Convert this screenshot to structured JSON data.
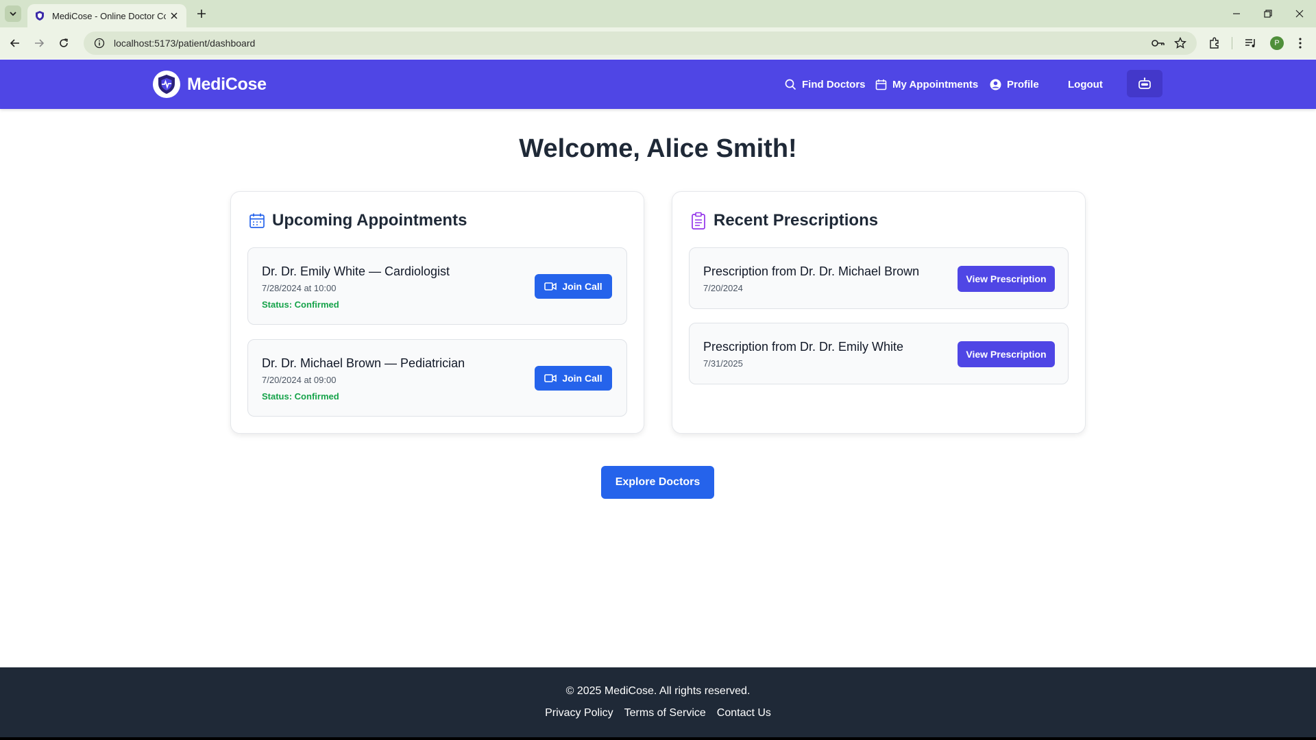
{
  "browser": {
    "tab_title": "MediCose - Online Doctor Con",
    "url": "localhost:5173/patient/dashboard",
    "profile_initial": "P"
  },
  "header": {
    "brand": "MediCose",
    "nav": {
      "find_doctors": "Find Doctors",
      "my_appointments": "My Appointments",
      "profile": "Profile",
      "logout": "Logout"
    }
  },
  "main": {
    "welcome": "Welcome, Alice Smith!",
    "appointments": {
      "title": "Upcoming Appointments",
      "items": [
        {
          "doctor": "Dr. Dr. Emily White — Cardiologist",
          "datetime": "7/28/2024 at 10:00",
          "status": "Status: Confirmed",
          "action": "Join Call"
        },
        {
          "doctor": "Dr. Dr. Michael Brown — Pediatrician",
          "datetime": "7/20/2024 at 09:00",
          "status": "Status: Confirmed",
          "action": "Join Call"
        }
      ]
    },
    "prescriptions": {
      "title": "Recent Prescriptions",
      "items": [
        {
          "label": "Prescription from Dr. Dr. Michael Brown",
          "date": "7/20/2024",
          "action": "View Prescription"
        },
        {
          "label": "Prescription from Dr. Dr. Emily White",
          "date": "7/31/2025",
          "action": "View Prescription"
        }
      ]
    },
    "explore_button": "Explore Doctors"
  },
  "footer": {
    "copyright": "© 2025 MediCose. All rights reserved.",
    "links": [
      "Privacy Policy",
      "Terms of Service",
      "Contact Us"
    ]
  },
  "colors": {
    "primary": "#4f46e5",
    "button_blue": "#2563eb",
    "status_green": "#16a34a",
    "footer_bg": "#1f2937"
  },
  "icons": {
    "tab_favicon": "shield-icon",
    "nav_find": "search-icon",
    "nav_appointments": "calendar-icon",
    "nav_profile": "user-circle-icon",
    "chatbot": "robot-icon",
    "appointments_header": "calendar-icon",
    "prescriptions_header": "clipboard-icon",
    "join_call": "video-camera-icon"
  }
}
